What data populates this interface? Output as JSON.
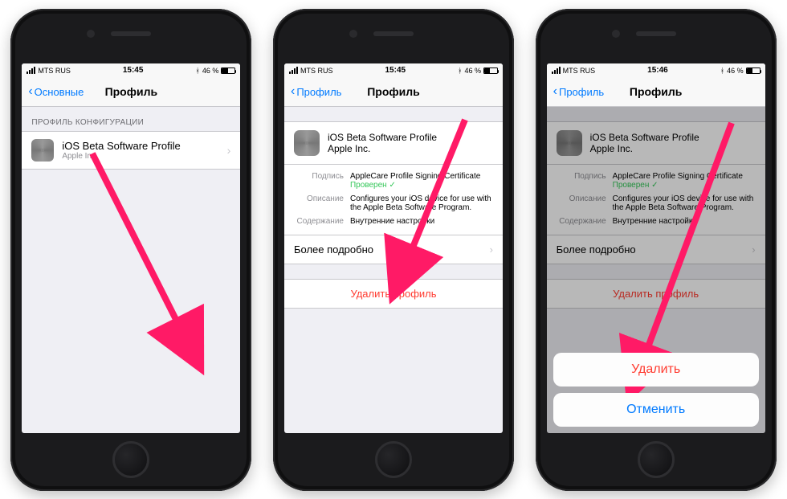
{
  "status": {
    "carrier": "MTS RUS",
    "time1": "15:45",
    "time2": "15:45",
    "time3": "15:46",
    "battery": "46 %"
  },
  "screen1": {
    "back": "Основные",
    "title": "Профиль",
    "section": "ПРОФИЛЬ КОНФИГУРАЦИИ",
    "profile_name": "iOS Beta Software Profile",
    "profile_org": "Apple Inc."
  },
  "screen2": {
    "back": "Профиль",
    "title": "Профиль",
    "profile_name": "iOS Beta Software Profile",
    "profile_org": "Apple Inc.",
    "k_sign": "Подпись",
    "v_sign": "AppleCare Profile Signing Certificate",
    "v_ver": "Проверен",
    "k_desc": "Описание",
    "v_desc": "Configures your iOS device for use with the Apple Beta Software Program.",
    "k_cont": "Содержание",
    "v_cont": "Внутренние настройки",
    "more": "Более подробно",
    "delete": "Удалить профиль"
  },
  "screen3": {
    "back": "Профиль",
    "title": "Профиль",
    "profile_name": "iOS Beta Software Profile",
    "profile_org": "Apple Inc.",
    "k_sign": "Подпись",
    "v_sign": "AppleCare Profile Signing Certificate",
    "v_ver": "Проверен",
    "k_desc": "Описание",
    "v_desc": "Configures your iOS device for use with the Apple Beta Software Program.",
    "k_cont": "Содержание",
    "v_cont": "Внутренние настройки",
    "more": "Более подробно",
    "delete": "Удалить профиль",
    "sheet_delete": "Удалить",
    "sheet_cancel": "Отменить"
  }
}
